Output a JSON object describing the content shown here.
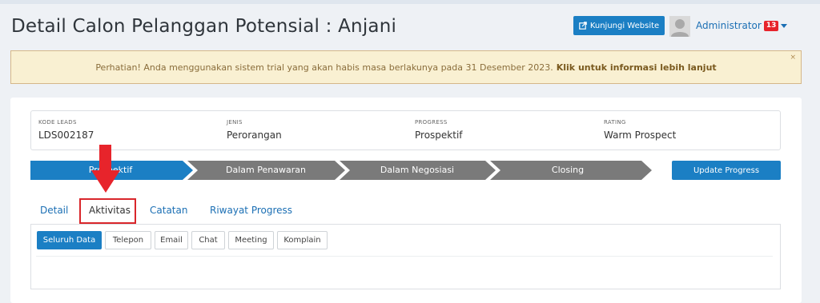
{
  "header": {
    "title": "Detail Calon Pelanggan Potensial : Anjani",
    "visit_button": "Kunjungi Website",
    "user_name": "Administrator",
    "notification_count": "13"
  },
  "alert": {
    "message": "Perhatian! Anda menggunakan sistem trial yang akan habis masa berlakunya pada 31 Desember 2023.",
    "link": "Klik untuk informasi lebih lanjut",
    "close": "×"
  },
  "info": {
    "kode_label": "KODE LEADS",
    "kode_value": "LDS002187",
    "jenis_label": "JENIS",
    "jenis_value": "Perorangan",
    "progress_label": "PROGRESS",
    "progress_value": "Prospektif",
    "rating_label": "RATING",
    "rating_value": "Warm Prospect"
  },
  "progress_steps": [
    {
      "label": "Prospektif",
      "active": true
    },
    {
      "label": "Dalam Penawaran",
      "active": false
    },
    {
      "label": "Dalam Negosiasi",
      "active": false
    },
    {
      "label": "Closing",
      "active": false
    }
  ],
  "update_button": "Update Progress",
  "tabs": [
    {
      "label": "Detail"
    },
    {
      "label": "Aktivitas"
    },
    {
      "label": "Catatan"
    },
    {
      "label": "Riwayat Progress"
    }
  ],
  "filters": [
    {
      "label": "Seluruh Data"
    },
    {
      "label": "Telepon"
    },
    {
      "label": "Email"
    },
    {
      "label": "Chat"
    },
    {
      "label": "Meeting"
    },
    {
      "label": "Komplain"
    }
  ],
  "colors": {
    "primary": "#1b7fc4",
    "step_inactive": "#7a7a7a",
    "highlight": "#e7242b",
    "alert_bg": "#f9f0d2"
  },
  "icons": {
    "visit": "external-link-icon",
    "avatar": "user-avatar-icon",
    "dropdown": "caret-down-icon",
    "annotation": "red-arrow-icon"
  }
}
